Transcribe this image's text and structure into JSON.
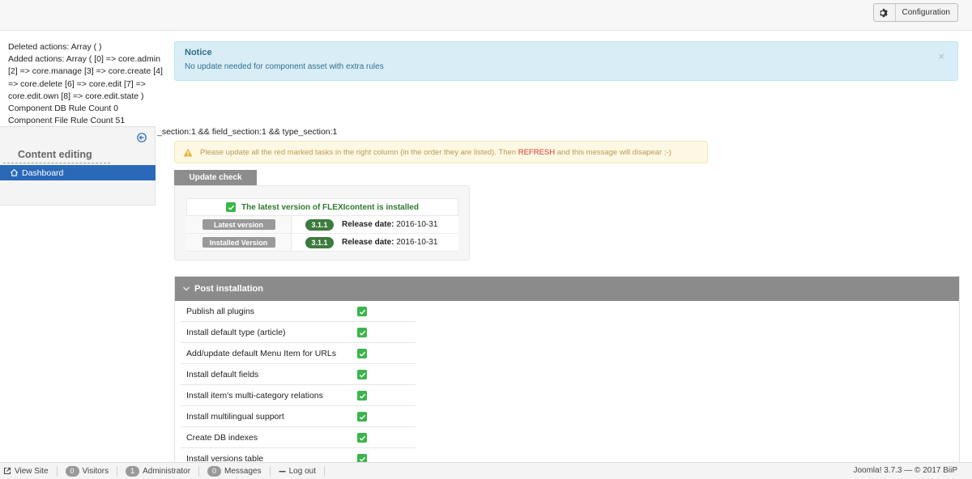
{
  "toolbar": {
    "config_label": "Configuration"
  },
  "debug": {
    "lines": [
      "Deleted actions: Array ( )",
      "Added actions: Array ( [0] => core.admin [2] => core.manage [3] => core.create [4] => core.delete [6] => core.edit [7] => core.edit.own [8] => core.edit.state )",
      "Component DB Rule Count 0",
      "Component File Rule Count 51"
    ],
    "sections": "_section:1 && field_section:1 && type_section:1"
  },
  "notice": {
    "title": "Notice",
    "message": "No update needed for component asset with extra rules",
    "close": "×"
  },
  "sidebar": {
    "heading": "Content editing",
    "items": [
      {
        "label": "Dashboard"
      }
    ]
  },
  "warning": {
    "text_before": "Please update all the red marked tasks in the right column (in the order they are listed). Then ",
    "refresh": "REFRESH",
    "text_after": " and this message will disapear ;-)"
  },
  "update_check": {
    "tab_label": "Update check",
    "status": "The latest version of FLEXIcontent is installed",
    "rows": [
      {
        "label": "Latest version",
        "version": "3.1.1",
        "date_label": "Release date:",
        "date": "2016-10-31"
      },
      {
        "label": "Installed Version",
        "version": "3.1.1",
        "date_label": "Release date:",
        "date": "2016-10-31"
      }
    ]
  },
  "post_installation": {
    "title": "Post installation",
    "tasks": [
      {
        "label": "Publish all plugins",
        "done": true
      },
      {
        "label": "Install default type (article)",
        "done": true
      },
      {
        "label": "Add/update default Menu Item for URLs",
        "done": true
      },
      {
        "label": "Install default fields",
        "done": true
      },
      {
        "label": "Install item's multi-category relations",
        "done": true
      },
      {
        "label": "Install multilingual support",
        "done": true
      },
      {
        "label": "Create DB indexes",
        "done": true
      },
      {
        "label": "Install versions table",
        "done": true
      }
    ]
  },
  "statusbar": {
    "view_site": "View Site",
    "visitors_count": "0",
    "visitors": "Visitors",
    "admin_count": "1",
    "admin": "Administrator",
    "messages_count": "0",
    "messages": "Messages",
    "logout": "Log out",
    "version": "Joomla! 3.7.3 — © 2017 BiiP"
  },
  "colors": {
    "accent": "#2a69b8",
    "success": "#3ab54a",
    "notice_bg": "#d9edf7"
  }
}
